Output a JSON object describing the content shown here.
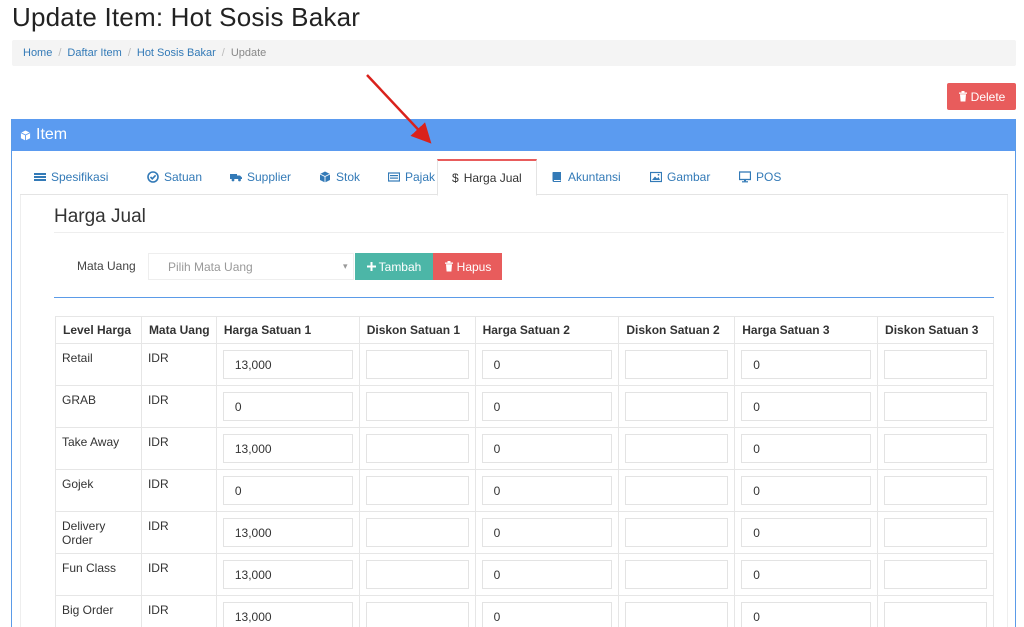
{
  "page": {
    "title": "Update Item: Hot Sosis Bakar"
  },
  "breadcrumb": [
    "Home",
    "Daftar Item",
    "Hot Sosis Bakar",
    "Update"
  ],
  "actions": {
    "delete_label": "Delete"
  },
  "panel": {
    "title": "Item"
  },
  "tabs": [
    {
      "label": "Spesifikasi",
      "icon": "list-icon"
    },
    {
      "label": "Satuan",
      "icon": "check-circle-icon"
    },
    {
      "label": "Supplier",
      "icon": "truck-icon"
    },
    {
      "label": "Stok",
      "icon": "cube-icon"
    },
    {
      "label": "Pajak",
      "icon": "receipt-icon"
    },
    {
      "label": "Harga Jual",
      "icon": "dollar-icon",
      "active": true
    },
    {
      "label": "Akuntansi",
      "icon": "book-icon"
    },
    {
      "label": "Gambar",
      "icon": "image-icon"
    },
    {
      "label": "POS",
      "icon": "monitor-icon"
    }
  ],
  "section": {
    "title": "Harga Jual",
    "currency_label": "Mata Uang",
    "currency_placeholder": "Pilih Mata Uang",
    "add_label": "Tambah",
    "remove_label": "Hapus"
  },
  "table": {
    "headers": [
      "Level Harga",
      "Mata Uang",
      "Harga Satuan 1",
      "Diskon Satuan 1",
      "Harga Satuan 2",
      "Diskon Satuan 2",
      "Harga Satuan 3",
      "Diskon Satuan 3"
    ],
    "rows": [
      {
        "level": "Retail",
        "currency": "IDR",
        "h1": "13,000",
        "d1": "",
        "h2": "0",
        "d2": "",
        "h3": "0",
        "d3": ""
      },
      {
        "level": "GRAB",
        "currency": "IDR",
        "h1": "0",
        "d1": "",
        "h2": "0",
        "d2": "",
        "h3": "0",
        "d3": ""
      },
      {
        "level": "Take Away",
        "currency": "IDR",
        "h1": "13,000",
        "d1": "",
        "h2": "0",
        "d2": "",
        "h3": "0",
        "d3": ""
      },
      {
        "level": "Gojek",
        "currency": "IDR",
        "h1": "0",
        "d1": "",
        "h2": "0",
        "d2": "",
        "h3": "0",
        "d3": ""
      },
      {
        "level": "Delivery Order",
        "currency": "IDR",
        "h1": "13,000",
        "d1": "",
        "h2": "0",
        "d2": "",
        "h3": "0",
        "d3": ""
      },
      {
        "level": "Fun Class",
        "currency": "IDR",
        "h1": "13,000",
        "d1": "",
        "h2": "0",
        "d2": "",
        "h3": "0",
        "d3": ""
      },
      {
        "level": "Big Order",
        "currency": "IDR",
        "h1": "13,000",
        "d1": "",
        "h2": "0",
        "d2": "",
        "h3": "0",
        "d3": ""
      }
    ]
  },
  "colors": {
    "accent": "#5b9bf0",
    "danger": "#e85c5c",
    "success": "#4cb6a7",
    "link": "#337ab7"
  }
}
